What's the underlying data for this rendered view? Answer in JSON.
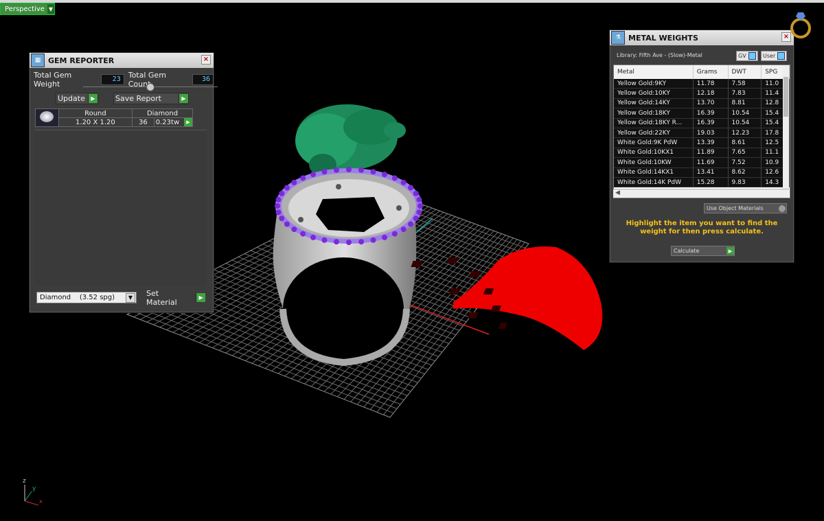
{
  "view": {
    "tab": "Perspective"
  },
  "gem_reporter": {
    "title": "GEM REPORTER",
    "weight_label": "Total Gem Weight",
    "weight_value": "23",
    "count_label": "Total Gem Count",
    "count_value": "36",
    "update_label": "Update",
    "save_label": "Save Report",
    "table_headers": [
      "Round",
      "Diamond"
    ],
    "row": {
      "size": "1.20 X 1.20",
      "count": "36",
      "weight": "0.23tw"
    },
    "material_select": "Diamond    (3.52 spg)",
    "set_material_label": "Set Material"
  },
  "metal_weights": {
    "title": "METAL WEIGHTS",
    "library": "Library: Fifth Ave - (Slow)-Metal",
    "chips": [
      "GV",
      "User"
    ],
    "headers": [
      "Metal",
      "Grams",
      "DWT",
      "SPG"
    ],
    "rows": [
      [
        "Yellow Gold:9KY",
        "11.78",
        "7.58",
        "11.0"
      ],
      [
        "Yellow Gold:10KY",
        "12.18",
        "7.83",
        "11.4"
      ],
      [
        "Yellow Gold:14KY",
        "13.70",
        "8.81",
        "12.8"
      ],
      [
        "Yellow Gold:18KY",
        "16.39",
        "10.54",
        "15.4"
      ],
      [
        "Yellow Gold:18KY R...",
        "16.39",
        "10.54",
        "15.4"
      ],
      [
        "Yellow Gold:22KY",
        "19.03",
        "12.23",
        "17.8"
      ],
      [
        "White Gold:9K PdW",
        "13.39",
        "8.61",
        "12.5"
      ],
      [
        "White Gold:10KX1",
        "11.89",
        "7.65",
        "11.1"
      ],
      [
        "White Gold:10KW",
        "11.69",
        "7.52",
        "10.9"
      ],
      [
        "White Gold:14KX1",
        "13.41",
        "8.62",
        "12.6"
      ],
      [
        "White Gold:14K PdW",
        "15.28",
        "9.83",
        "14.3"
      ]
    ],
    "use_object": "Use Object Materials",
    "hint": "Highlight the item you want to find the weight for then press calculate.",
    "calculate": "Calculate"
  },
  "axis": {
    "z": "z",
    "y": "y",
    "x": "x"
  }
}
